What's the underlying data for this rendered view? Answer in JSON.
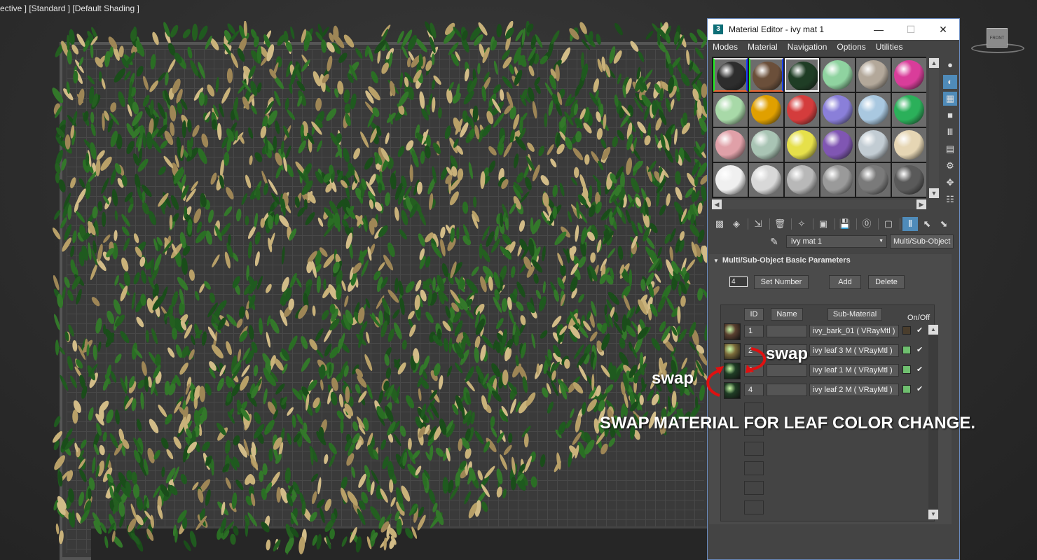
{
  "viewport": {
    "label": "ective ] [Standard ] [Default Shading ]",
    "viewcube_label": "FRONT"
  },
  "material_editor": {
    "app_icon": "3",
    "title": "Material Editor -  ivy mat 1",
    "window_buttons": {
      "minimize": "—",
      "maximize": "☐",
      "close": "✕"
    },
    "menu": [
      "Modes",
      "Material",
      "Navigation",
      "Options",
      "Utilities"
    ],
    "sample_slots": [
      {
        "color": "#2d2d2d",
        "assigned": true
      },
      {
        "color": "#6b4f3a",
        "assigned": true
      },
      {
        "color": "#1f3d25",
        "assigned": true,
        "active": true
      },
      {
        "color": "#8fd3a0"
      },
      {
        "color": "#b3a89a"
      },
      {
        "color": "#d93d9a"
      },
      {
        "color": "#a8d9a8"
      },
      {
        "color": "#e0a000"
      },
      {
        "color": "#d43c3c"
      },
      {
        "color": "#8a7fd9"
      },
      {
        "color": "#a9c8e0"
      },
      {
        "color": "#2bb05a"
      },
      {
        "color": "#e0a0a8"
      },
      {
        "color": "#a9c4b4"
      },
      {
        "color": "#e6e04a"
      },
      {
        "color": "#8056b3"
      },
      {
        "color": "#c2ccd3"
      },
      {
        "color": "#e6d6b4"
      },
      {
        "color": "#f0f0f0"
      },
      {
        "color": "#d8d8d8"
      },
      {
        "color": "#b8b8b8"
      },
      {
        "color": "#9a9a9a"
      },
      {
        "color": "#7a7a7a"
      },
      {
        "color": "#5a5a5a"
      }
    ],
    "material_name": "ivy mat 1",
    "material_type": "Multi/Sub-Object",
    "rollout": {
      "title": "Multi/Sub-Object Basic Parameters",
      "number_value": "4",
      "set_number_label": "Set Number",
      "add_label": "Add",
      "delete_label": "Delete",
      "headers": {
        "id": "ID",
        "name": "Name",
        "sub_material": "Sub-Material",
        "on_off": "On/Off"
      },
      "rows": [
        {
          "id": "1",
          "sub_material": "ivy_bark_01  ( VRayMtl )",
          "thumb": "#5a4030",
          "swatch": "#4a3d2c",
          "check": "✔"
        },
        {
          "id": "2",
          "sub_material": "ivy  leaf 3 M  ( VRayMtl )",
          "thumb": "#7a6a3a",
          "swatch": "#6fbf6f",
          "check": "✔"
        },
        {
          "id": "3",
          "sub_material": "ivy  leaf 1 M  ( VRayMtl )",
          "thumb": "#1f3d25",
          "swatch": "#6fbf6f",
          "check": "✔"
        },
        {
          "id": "4",
          "sub_material": "ivy  leaf 2 M  ( VRayMtl )",
          "thumb": "#1f3d25",
          "swatch": "#6fbf6f",
          "check": "✔"
        }
      ]
    }
  },
  "annotations": {
    "swap_right": "swap",
    "swap_left": "swap",
    "caption": "SWAP MATERIAL FOR LEAF COLOR CHANGE.",
    "arrow_color": "#e01010"
  }
}
